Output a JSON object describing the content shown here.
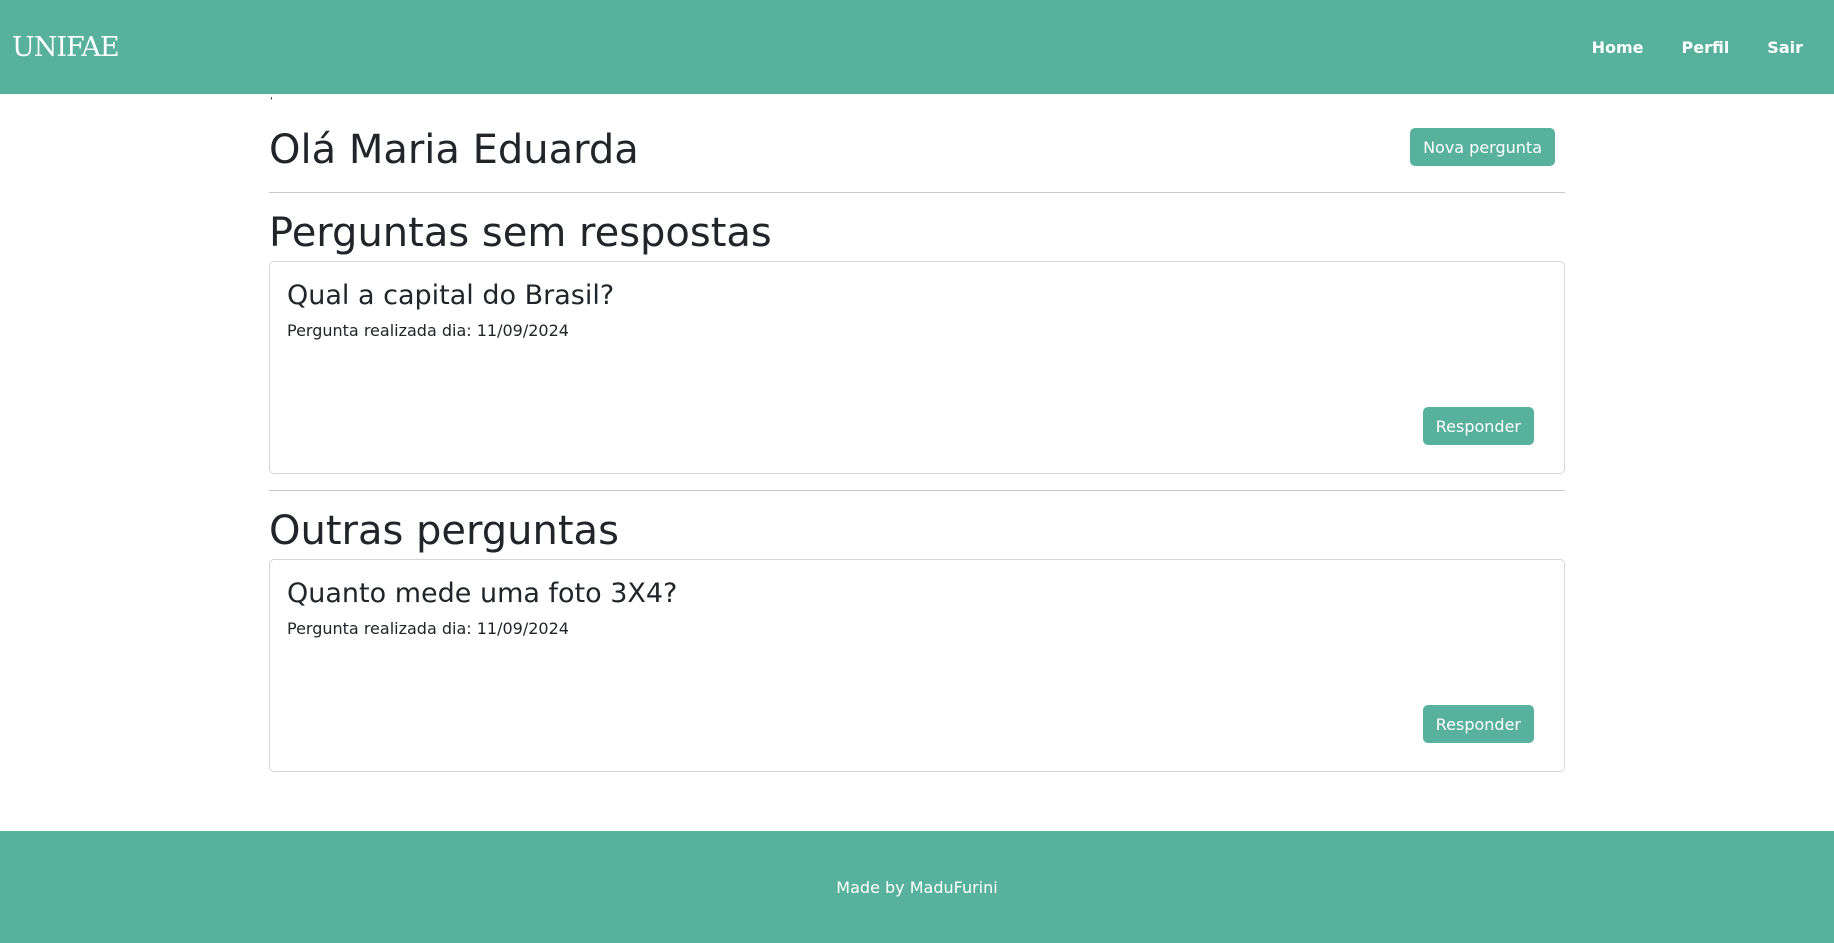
{
  "navbar": {
    "logo": "UNIFAE",
    "links": [
      "Home",
      "Perfil",
      "Sair"
    ]
  },
  "header": {
    "greeting": "Olá Maria Eduarda",
    "new_question_label": "Nova pergunta",
    "tick": "'"
  },
  "sections": [
    {
      "title": "Perguntas sem respostas",
      "questions": [
        {
          "title": "Qual a capital do Brasil?",
          "date": "Pergunta realizada dia: 11/09/2024",
          "button": "Responder"
        }
      ]
    },
    {
      "title": "Outras perguntas",
      "questions": [
        {
          "title": "Quanto mede uma foto 3X4?",
          "date": "Pergunta realizada dia: 11/09/2024",
          "button": "Responder"
        }
      ]
    }
  ],
  "footer": {
    "text": "Made by MaduFurini"
  },
  "colors": {
    "brand": "#58b19c",
    "text": "#212529"
  }
}
